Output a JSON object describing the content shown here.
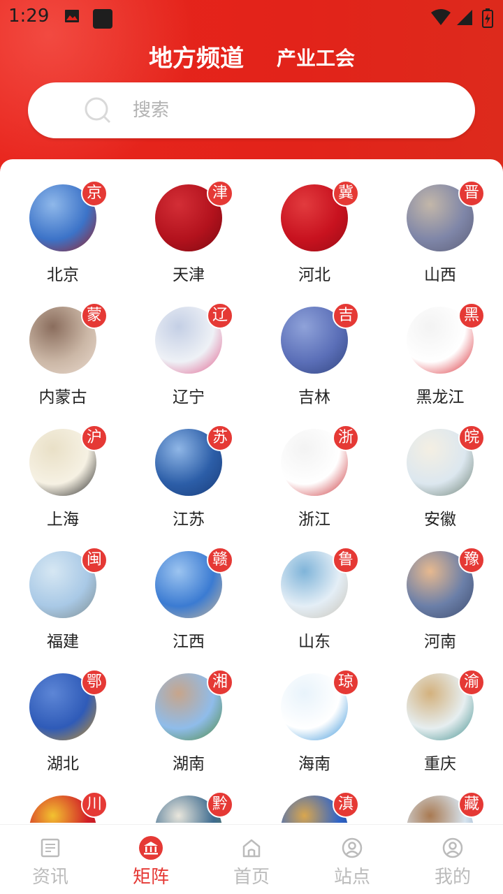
{
  "status_bar": {
    "time": "1:29"
  },
  "header": {
    "main_channel": "地方频道",
    "sub_channel": "产业工会"
  },
  "search": {
    "placeholder": "搜索"
  },
  "provinces": [
    {
      "name": "北京",
      "badge": "京",
      "colors": [
        "#3c73c8",
        "#8fb8ea",
        "#9d1f24"
      ]
    },
    {
      "name": "天津",
      "badge": "津",
      "colors": [
        "#b3121d",
        "#d32e36",
        "#7d0a12"
      ]
    },
    {
      "name": "河北",
      "badge": "冀",
      "colors": [
        "#c8121f",
        "#e23b3e",
        "#9a0c16"
      ]
    },
    {
      "name": "山西",
      "badge": "晋",
      "colors": [
        "#7f86a8",
        "#c3b7a9",
        "#5d5f78"
      ]
    },
    {
      "name": "内蒙古",
      "badge": "蒙",
      "colors": [
        "#cbb7a6",
        "#8a6d5d",
        "#e9d9cd"
      ]
    },
    {
      "name": "辽宁",
      "badge": "辽",
      "colors": [
        "#eef1f6",
        "#c4cfe5",
        "#e05a8a"
      ]
    },
    {
      "name": "吉林",
      "badge": "吉",
      "colors": [
        "#5b6fb8",
        "#8fa2d9",
        "#32457f"
      ]
    },
    {
      "name": "黑龙江",
      "badge": "黑",
      "colors": [
        "#ffffff",
        "#f3f3f3",
        "#d8202a"
      ]
    },
    {
      "name": "上海",
      "badge": "沪",
      "colors": [
        "#f6f1e3",
        "#e9e0c7",
        "#1c1c1c"
      ]
    },
    {
      "name": "江苏",
      "badge": "苏",
      "colors": [
        "#2c5ea8",
        "#8fb6e6",
        "#1a3d7a"
      ]
    },
    {
      "name": "浙江",
      "badge": "浙",
      "colors": [
        "#ffffff",
        "#f3f3f3",
        "#c8282e"
      ]
    },
    {
      "name": "安徽",
      "badge": "皖",
      "colors": [
        "#dce7ef",
        "#f4efe3",
        "#6b7f72"
      ]
    },
    {
      "name": "福建",
      "badge": "闽",
      "colors": [
        "#a9c9e6",
        "#d6e7f3",
        "#7d8c8f"
      ]
    },
    {
      "name": "江西",
      "badge": "赣",
      "colors": [
        "#3b7bd2",
        "#9cc4f0",
        "#c9b79a"
      ]
    },
    {
      "name": "山东",
      "badge": "鲁",
      "colors": [
        "#e4eef6",
        "#7fb4d9",
        "#c7c2b6"
      ]
    },
    {
      "name": "河南",
      "badge": "豫",
      "colors": [
        "#6b7fa8",
        "#e7b98f",
        "#3e4c6e"
      ]
    },
    {
      "name": "湖北",
      "badge": "鄂",
      "colors": [
        "#2f5bb8",
        "#5d86d6",
        "#c9952a"
      ]
    },
    {
      "name": "湖南",
      "badge": "湘",
      "colors": [
        "#8fbcea",
        "#c7a58b",
        "#4e8a3d"
      ]
    },
    {
      "name": "海南",
      "badge": "琼",
      "colors": [
        "#ffffff",
        "#e8f3fb",
        "#2f8fd8"
      ]
    },
    {
      "name": "重庆",
      "badge": "渝",
      "colors": [
        "#e6eef0",
        "#d3b17d",
        "#3d8c8a"
      ]
    },
    {
      "name": "",
      "badge": "川",
      "colors": [
        "#d11f27",
        "#f2c230",
        "#b0141b"
      ]
    },
    {
      "name": "",
      "badge": "黔",
      "colors": [
        "#3d6b8f",
        "#e9e6dc",
        "#5d7d4a"
      ]
    },
    {
      "name": "",
      "badge": "滇",
      "colors": [
        "#2f64c8",
        "#d9a64e",
        "#1d3f8a"
      ]
    },
    {
      "name": "",
      "badge": "藏",
      "colors": [
        "#d7e4ef",
        "#a97a52",
        "#6f8db0"
      ]
    }
  ],
  "bottom_nav": [
    {
      "label": "资讯",
      "icon": "news-icon",
      "active": false
    },
    {
      "label": "矩阵",
      "icon": "bank-icon",
      "active": true
    },
    {
      "label": "首页",
      "icon": "home-icon",
      "active": false
    },
    {
      "label": "站点",
      "icon": "station-icon",
      "active": false
    },
    {
      "label": "我的",
      "icon": "user-icon",
      "active": false
    }
  ],
  "colors": {
    "brand_red": "#e2231a",
    "badge_red": "#e53935",
    "inactive_gray": "#bbbbbb"
  }
}
